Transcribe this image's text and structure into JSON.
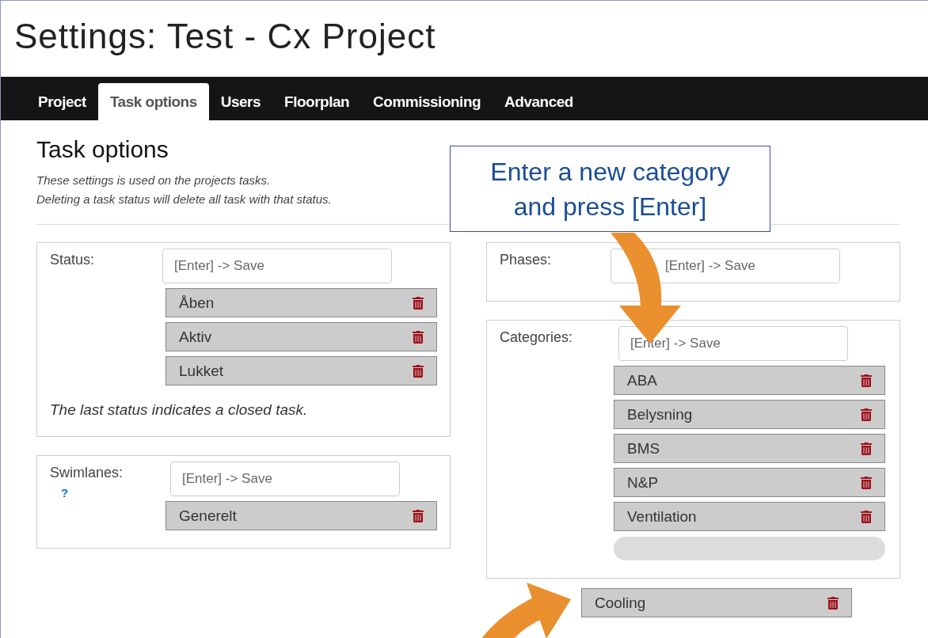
{
  "window": {
    "title": "Settings: Test - Cx Project"
  },
  "tabs": [
    {
      "label": "Project",
      "selected": false
    },
    {
      "label": "Task options",
      "selected": true
    },
    {
      "label": "Users",
      "selected": false
    },
    {
      "label": "Floorplan",
      "selected": false
    },
    {
      "label": "Commissioning",
      "selected": false
    },
    {
      "label": "Advanced",
      "selected": false
    }
  ],
  "section": {
    "title": "Task options",
    "notes": [
      "These settings is used on the projects tasks.",
      "Deleting a task status will delete all task with that status."
    ]
  },
  "columns": [
    {
      "panels": [
        {
          "label": "Status:",
          "placeholder": "[Enter] -> Save",
          "items": [
            {
              "label": "Åben"
            },
            {
              "label": "Aktiv"
            },
            {
              "label": "Lukket"
            }
          ],
          "note": "The last status indicates a closed task."
        },
        {
          "label": "Swimlanes:",
          "help": "?",
          "placeholder": "[Enter] -> Save",
          "items": [
            {
              "label": "Generelt"
            }
          ]
        }
      ]
    },
    {
      "panels": [
        {
          "label": "Phases:",
          "placeholder": "[Enter] -> Save"
        },
        {
          "label": "Categories:",
          "placeholder": "[Enter] -> Save",
          "items": [
            {
              "label": "ABA"
            },
            {
              "label": "Belysning"
            },
            {
              "label": "BMS"
            },
            {
              "label": "N&P"
            },
            {
              "label": "Ventilation"
            }
          ],
          "dragged_item": {
            "label": "Cooling"
          }
        }
      ]
    }
  ],
  "callout": {
    "text": "Enter a new category and press [Enter]"
  }
}
